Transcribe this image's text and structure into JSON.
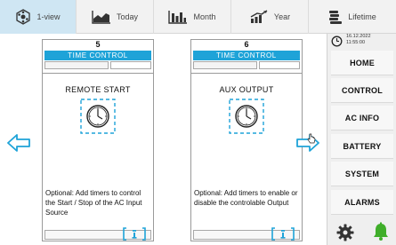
{
  "tabs": [
    {
      "label": "1-view",
      "icon": "gear-hexagon-icon",
      "active": true
    },
    {
      "label": "Today",
      "icon": "area-chart-icon",
      "active": false
    },
    {
      "label": "Month",
      "icon": "bar-chart-icon",
      "active": false
    },
    {
      "label": "Year",
      "icon": "trend-chart-icon",
      "active": false
    },
    {
      "label": "Lifetime",
      "icon": "coin-stack-icon",
      "active": false
    }
  ],
  "panels": [
    {
      "number": "5",
      "header": "TIME CONTROL",
      "title": "REMOTE START",
      "icon": "clock-icon",
      "description": "Optional: Add timers to control the Start / Stop of the AC Input Source"
    },
    {
      "number": "6",
      "header": "TIME CONTROL",
      "title": "AUX OUTPUT",
      "icon": "clock-icon",
      "description": "Optional: Add timers to enable or disable the controlable Output"
    }
  ],
  "sidebar": {
    "date": "16.12.2022",
    "time": "11:55:00",
    "items": [
      "HOME",
      "CONTROL",
      "AC INFO",
      "BATTERY",
      "SYSTEM",
      "ALARMS"
    ]
  },
  "colors": {
    "accent": "#1ea3d8",
    "active_tab": "#cfe6f3",
    "alarm_bell": "#3fae2a"
  }
}
